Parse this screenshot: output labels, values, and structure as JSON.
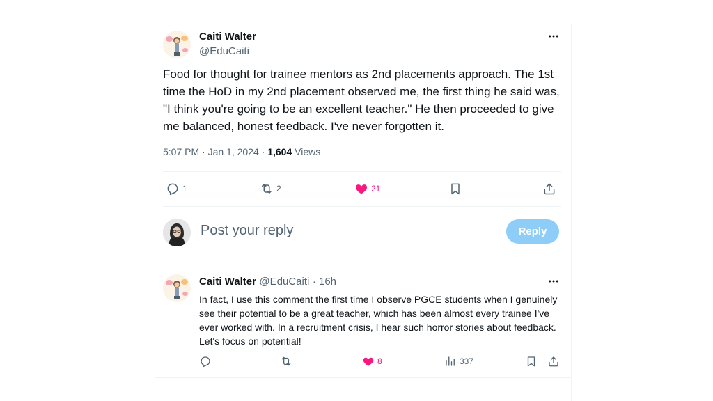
{
  "tweet": {
    "author_name": "Caiti Walter",
    "author_handle": "@EduCaiti",
    "text": "Food for thought for trainee mentors as 2nd placements approach. The 1st time the HoD in my 2nd placement observed me, the first thing he said was, \"I think you're going to be an excellent teacher.\" He then proceeded to give me balanced, honest feedback. I've never forgotten it.",
    "time": "5:07 PM · Jan 1, 2024 · ",
    "views_count": "1,604",
    "views_label": " Views",
    "replies": "1",
    "retweets": "2",
    "likes": "21"
  },
  "composer": {
    "placeholder": "Post your reply",
    "button_label": "Reply"
  },
  "reply": {
    "author_name": "Caiti Walter",
    "author_handle": "@EduCaiti",
    "time": "· 16h",
    "text": "In fact, I use this comment the first time I observe PGCE students when I genuinely see their potential to be a great teacher, which has been almost every trainee I've ever worked with. In a recruitment crisis, I hear such horror stories about feedback. Let's focus on potential!",
    "likes": "8",
    "views": "337"
  },
  "colors": {
    "like": "#f91880",
    "muted": "#536471",
    "reply_button": "#8ecdf8"
  }
}
